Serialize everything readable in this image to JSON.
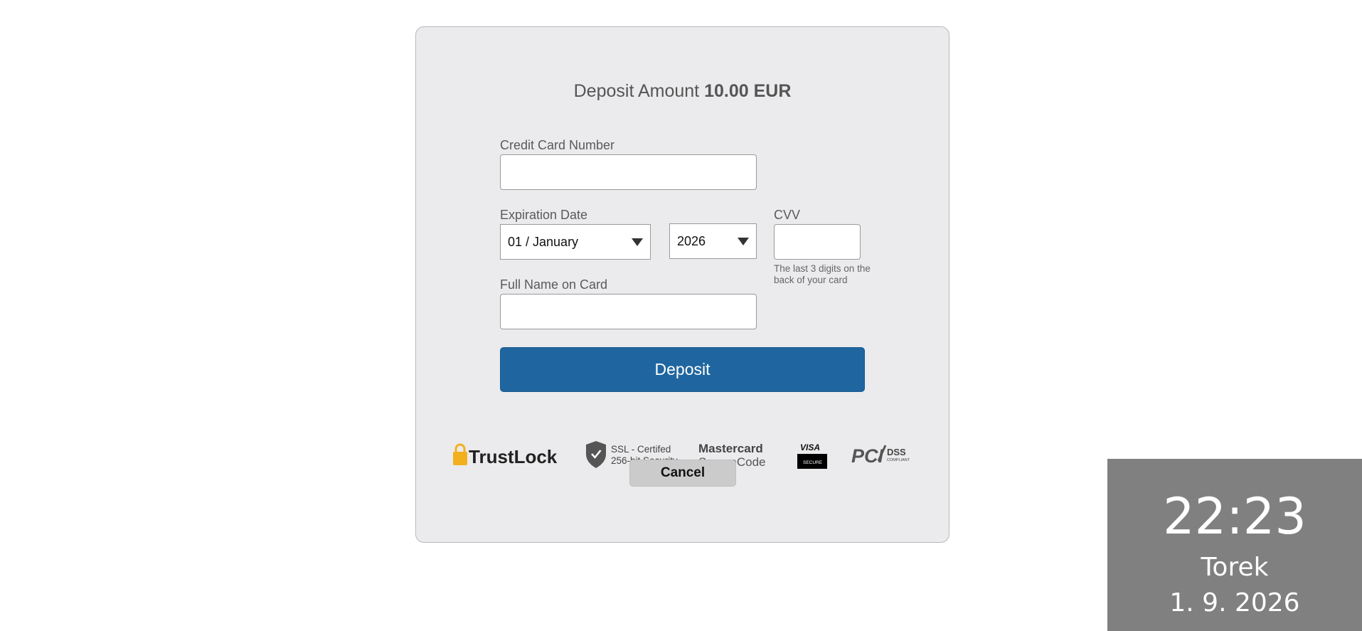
{
  "title": {
    "prefix": "Deposit Amount",
    "amount": "10.00 EUR"
  },
  "form": {
    "card_number_label": "Credit Card Number",
    "card_number_value": "",
    "expiration_label": "Expiration Date",
    "month_selected": "01 / January",
    "year_selected": "2026",
    "cvv_label": "CVV",
    "cvv_value": "",
    "cvv_hint": "The last 3 digits on the back of your card",
    "name_label": "Full Name on Card",
    "name_value": ""
  },
  "buttons": {
    "deposit": "Deposit",
    "cancel": "Cancel"
  },
  "badges": {
    "trustlock": "TrustLock",
    "ssl_line1": "SSL - Certifed",
    "ssl_line2": "256-bit Security",
    "mastercard_line1": "Mastercard",
    "mastercard_line2": "SecureCode",
    "visa_line1": "VISA",
    "visa_line2": "SECURE",
    "pci": "PCI",
    "dss": "DSS",
    "dss_sub": "COMPLIANT"
  },
  "clock": {
    "time": "22:23",
    "day": "Torek",
    "date": "1. 9. 2026"
  },
  "icons": [
    "padlock-icon",
    "shield-check-icon",
    "dropdown-arrow-icon"
  ],
  "colors": {
    "primary_button": "#1f66a0",
    "card_bg": "#ebebed",
    "cancel_bg": "#cbcbcb",
    "clock_bg": "#808080",
    "trustlock_gold": "#f2b01e"
  }
}
